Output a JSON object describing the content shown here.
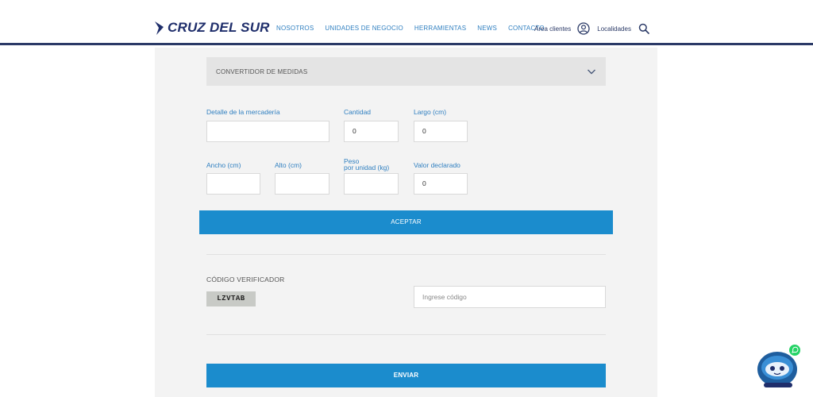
{
  "header": {
    "brand": "CRUZ DEL SUR",
    "nav": [
      "NOSOTROS",
      "UNIDADES DE NEGOCIO",
      "HERRAMIENTAS",
      "NEWS",
      "CONTACTO"
    ],
    "clients_area": "Área clientes",
    "locations": "Localidades"
  },
  "accordion": {
    "label": "CONVERTIDOR DE MEDIDAS"
  },
  "form": {
    "detalle_label": "Detalle de la mercadería",
    "detalle_value": "",
    "cantidad_label": "Cantidad",
    "cantidad_value": "0",
    "largo_label": "Largo (cm)",
    "largo_value": "0",
    "ancho_label": "Ancho (cm)",
    "ancho_value": "",
    "alto_label": "Alto (cm)",
    "alto_value": "",
    "peso_label_line1": "Peso",
    "peso_label_line2": "por unidad (kg)",
    "peso_value": "",
    "valor_label": "Valor declarado",
    "valor_value": "0",
    "accept_button": "ACEPTAR"
  },
  "verification": {
    "title": "CÓDIGO VERIFICADOR",
    "code": "LZVTAB",
    "input_placeholder": "Ingrese código",
    "send_button": "ENVIAR"
  },
  "colors": {
    "brand_navy": "#1f2e6b",
    "accent_blue": "#1b8ccd",
    "link_blue": "#2f7fc0",
    "whatsapp_green": "#25d366"
  },
  "icons": [
    "brand-chevron-icon",
    "user-circle-icon",
    "search-icon",
    "chevron-down-icon",
    "whatsapp-icon"
  ]
}
